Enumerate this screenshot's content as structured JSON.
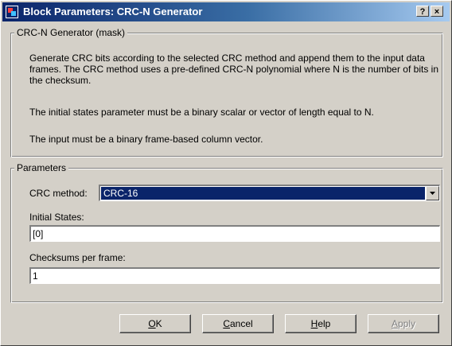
{
  "window": {
    "title": "Block Parameters: CRC-N Generator",
    "help_glyph": "?",
    "close_glyph": "×"
  },
  "mask_group": {
    "legend": "CRC-N Generator (mask)",
    "paragraphs": [
      "Generate CRC bits according to the selected CRC method and append them to the input data frames. The CRC method uses a pre-defined CRC-N polynomial where N is the number of bits in the checksum.",
      "The initial states parameter must be a binary scalar or vector of length equal to N.",
      "The input must be a binary frame-based column vector."
    ]
  },
  "parameters_group": {
    "legend": "Parameters",
    "crc_method": {
      "label": "CRC method:",
      "value": "CRC-16"
    },
    "initial_states": {
      "label": "Initial States:",
      "value": "[0]"
    },
    "checksums": {
      "label": "Checksums per frame:",
      "value": "1"
    }
  },
  "buttons": {
    "ok": {
      "pre": "",
      "key": "O",
      "post": "K"
    },
    "cancel": {
      "pre": "",
      "key": "C",
      "post": "ancel"
    },
    "help": {
      "pre": "",
      "key": "H",
      "post": "elp"
    },
    "apply": {
      "pre": "",
      "key": "A",
      "post": "pply"
    }
  },
  "colors": {
    "face": "#d4d0c8",
    "title_active": "#0a246a",
    "selection": "#0a246a"
  },
  "icons": {
    "title": "simulink-block-icon",
    "dropdown": "chevron-down-icon"
  }
}
